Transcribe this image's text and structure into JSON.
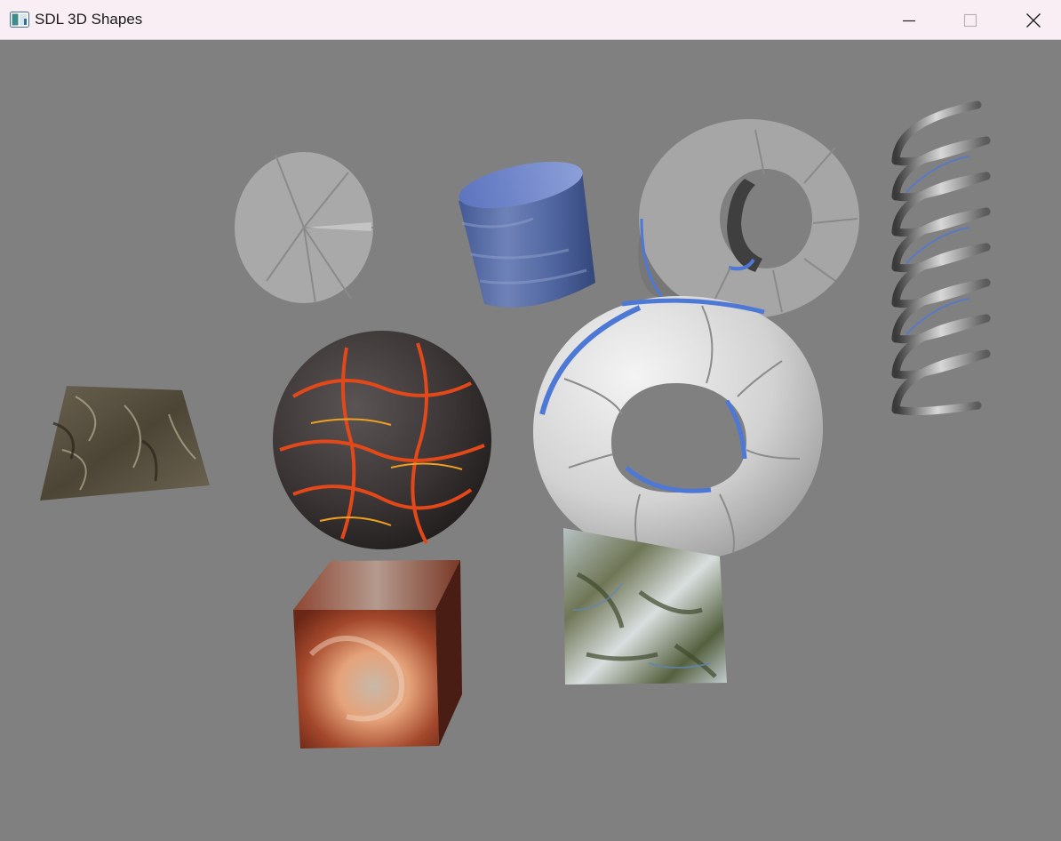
{
  "window": {
    "title": "SDL 3D Shapes",
    "icon": "sdl-app-icon",
    "controls": {
      "minimize_icon": "minimize-icon",
      "maximize_icon": "maximize-icon",
      "close_icon": "close-icon"
    }
  },
  "canvas": {
    "background": "#808080",
    "shapes": [
      {
        "name": "disc-gray",
        "kind": "disc",
        "color": "#a9a9a9"
      },
      {
        "name": "cylinder-blue-marble",
        "kind": "cylinder",
        "color": "#5b6fa8"
      },
      {
        "name": "tube-ring-gray",
        "kind": "tube",
        "color": "#a6a6a6"
      },
      {
        "name": "spring-metal",
        "kind": "spring",
        "color": "#9aa0aa"
      },
      {
        "name": "cone-frustum-bark",
        "kind": "frustum",
        "color": "#5b5346"
      },
      {
        "name": "sphere-lava",
        "kind": "sphere",
        "color": "#3a3636"
      },
      {
        "name": "torus-white-blue",
        "kind": "torus",
        "color": "#d6d6d6"
      },
      {
        "name": "cube-nebula",
        "kind": "cube",
        "color": "#8a3a22"
      },
      {
        "name": "plane-terrain",
        "kind": "plane",
        "color": "#8a8f78"
      }
    ]
  }
}
